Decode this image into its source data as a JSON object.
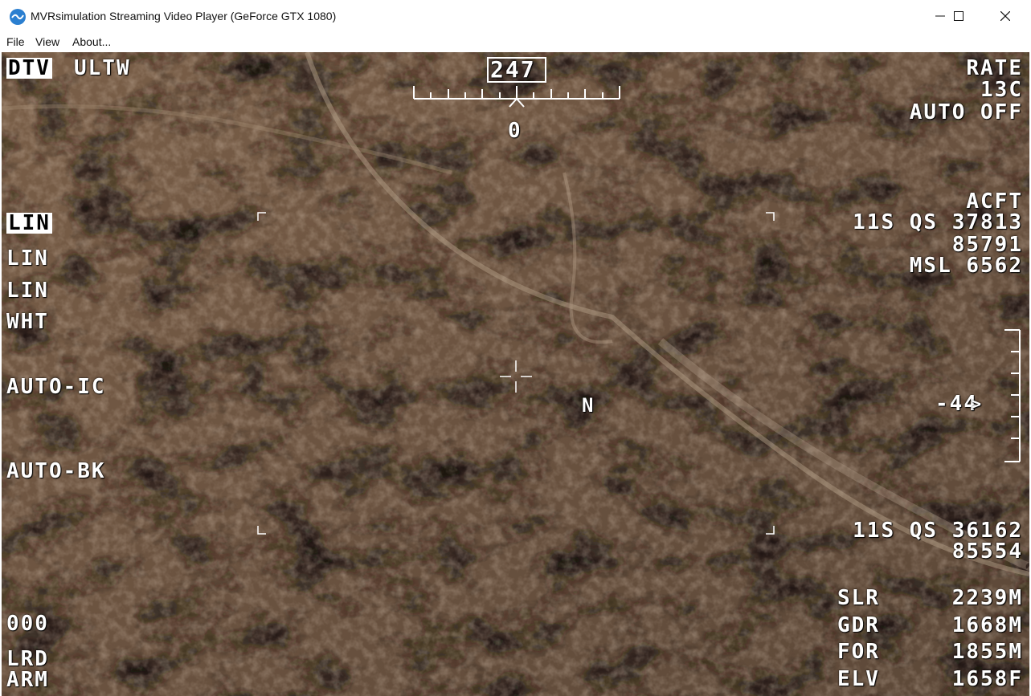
{
  "window": {
    "title": "MVRsimulation Streaming Video Player  (GeForce GTX 1080)",
    "icon": "app-logo-icon",
    "controls": [
      "minimize-icon",
      "maximize-icon",
      "close-icon"
    ]
  },
  "menu": [
    "File",
    "View",
    "About..."
  ],
  "hud": {
    "mode": "DTV",
    "fov": "ULTW",
    "left_settings": [
      "LIN",
      "LIN",
      "LIN",
      "WHT"
    ],
    "auto_ic": "AUTO-IC",
    "auto_bk": "AUTO-BK",
    "code": "000",
    "lrd": "LRD",
    "arm": "ARM",
    "heading": "247",
    "heading_offset": "0",
    "rate": "RATE",
    "temp": "13C",
    "auto": "AUTO OFF",
    "acft_label": "ACFT",
    "acft_grid": "11S QS 37813",
    "acft_north": "85791",
    "acft_msl": "MSL 6562",
    "depression": "-44",
    "depression_marker": ">",
    "north": "N",
    "target_grid": "11S QS 36162",
    "target_north": "85554",
    "ranges": [
      {
        "label": "SLR",
        "value": "2239M"
      },
      {
        "label": "GDR",
        "value": "1668M"
      },
      {
        "label": "FOR",
        "value": "1855M"
      },
      {
        "label": "ELV",
        "value": "1658F"
      }
    ]
  },
  "colors": {
    "hud": "#ffffff",
    "terrain": "#5a4534"
  }
}
